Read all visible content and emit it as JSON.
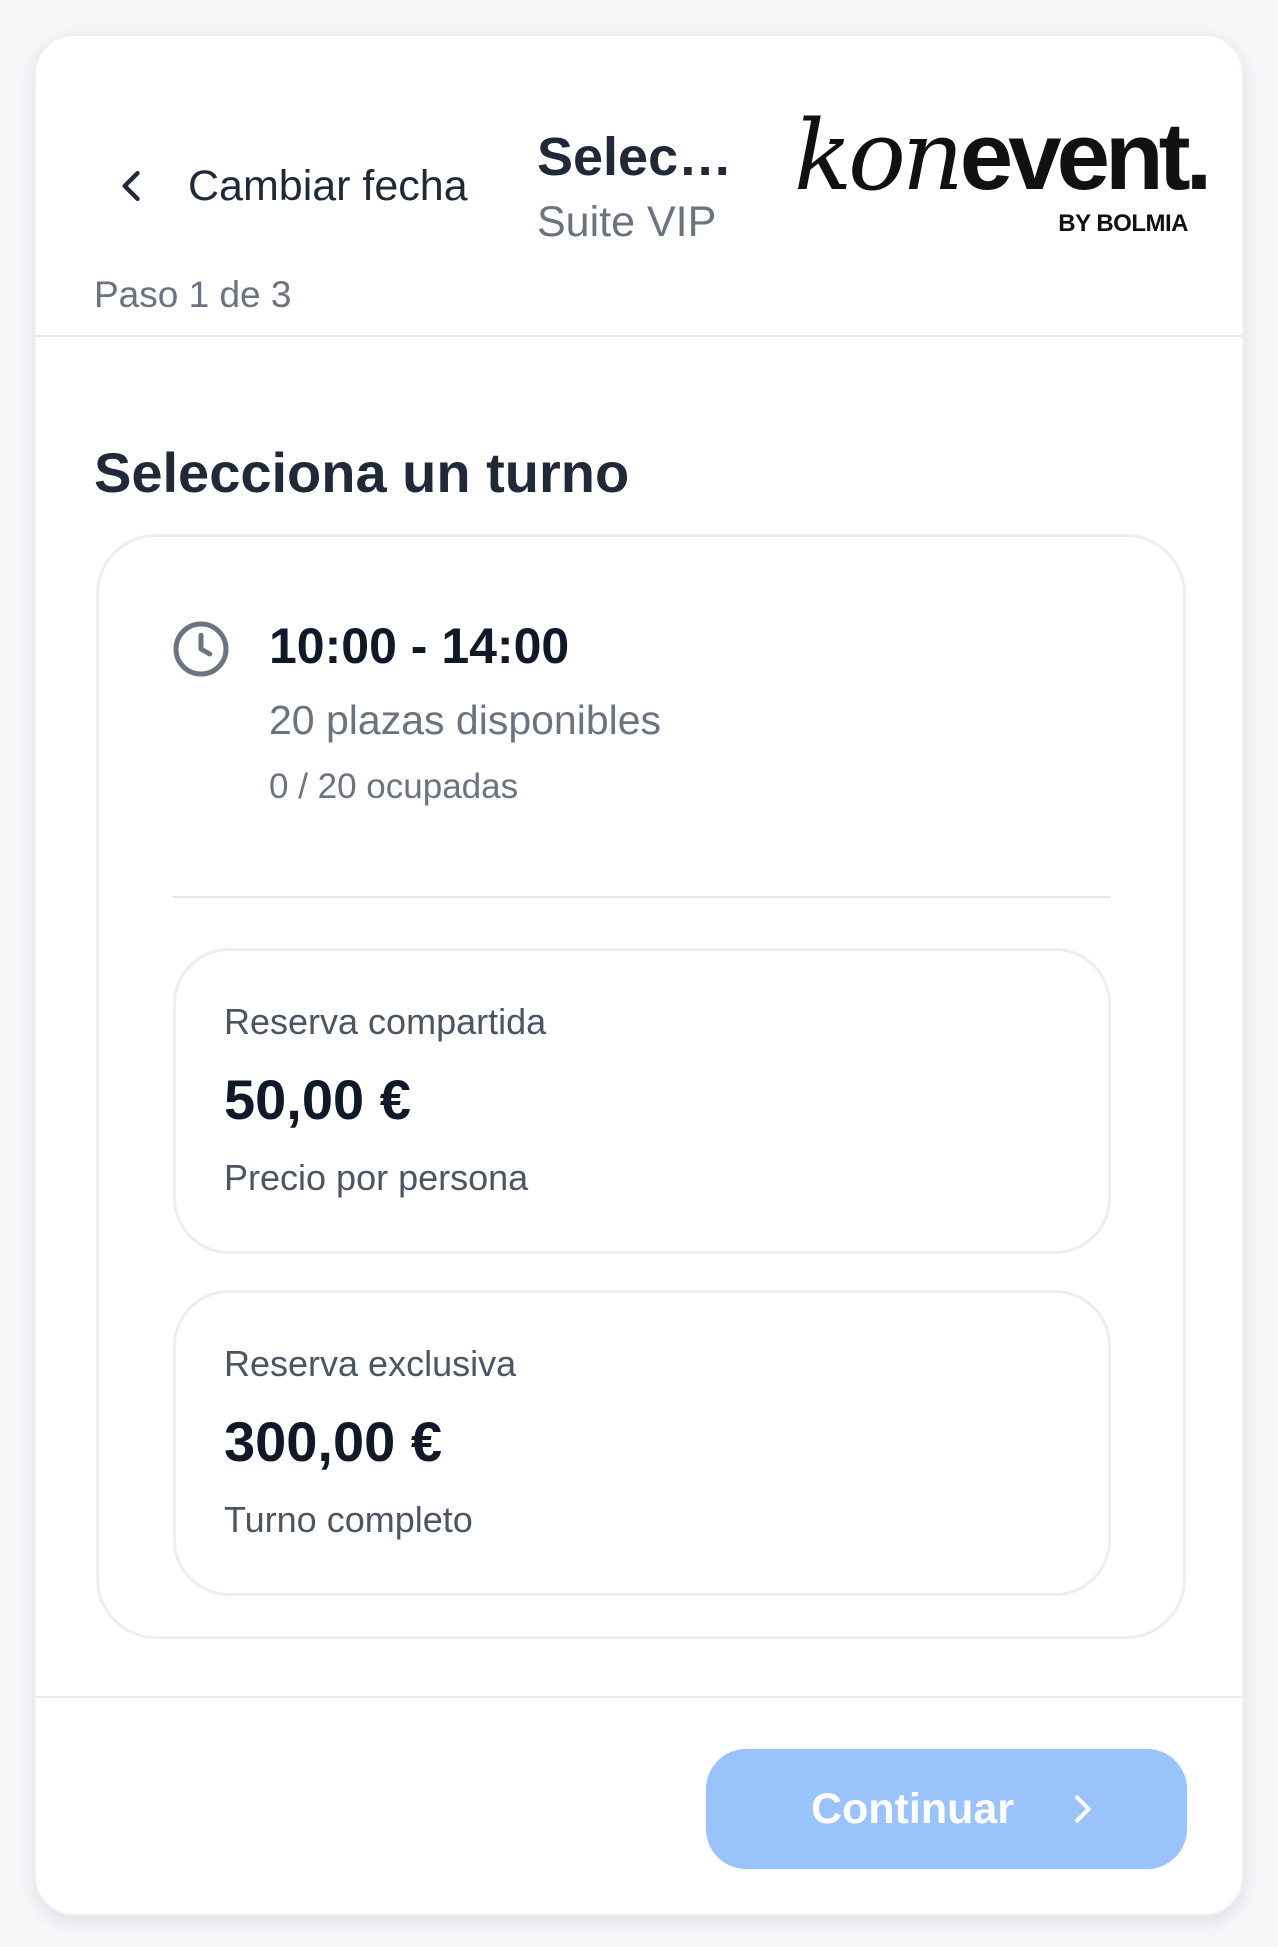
{
  "header": {
    "back_label": "Cambiar fecha",
    "step_text": "Paso 1 de 3",
    "title": "Selecciona un turno",
    "subtitle": "Suite VIP",
    "logo": {
      "brand_kon": "kon",
      "brand_event": "event.",
      "byline": "BY BOLMIA"
    }
  },
  "section_title": "Selecciona un turno",
  "slot": {
    "time": "10:00 - 14:00",
    "available": "20 plazas disponibles",
    "occupied": "0 / 20 ocupadas",
    "options": [
      {
        "label": "Reserva compartida",
        "price": "50,00 €",
        "note": "Precio por persona"
      },
      {
        "label": "Reserva exclusiva",
        "price": "300,00 €",
        "note": "Turno completo"
      }
    ]
  },
  "footer": {
    "continue_label": "Continuar",
    "continue_disabled": true
  },
  "icons": {
    "back": "chevron-left-icon",
    "clock": "clock-icon",
    "continue": "chevron-right-icon"
  },
  "colors": {
    "primary_button_disabled": "#9bc3fb",
    "text_primary": "#1f2937",
    "text_secondary": "#6b7280",
    "border": "#eceef1",
    "background": "#f6f7f9"
  }
}
